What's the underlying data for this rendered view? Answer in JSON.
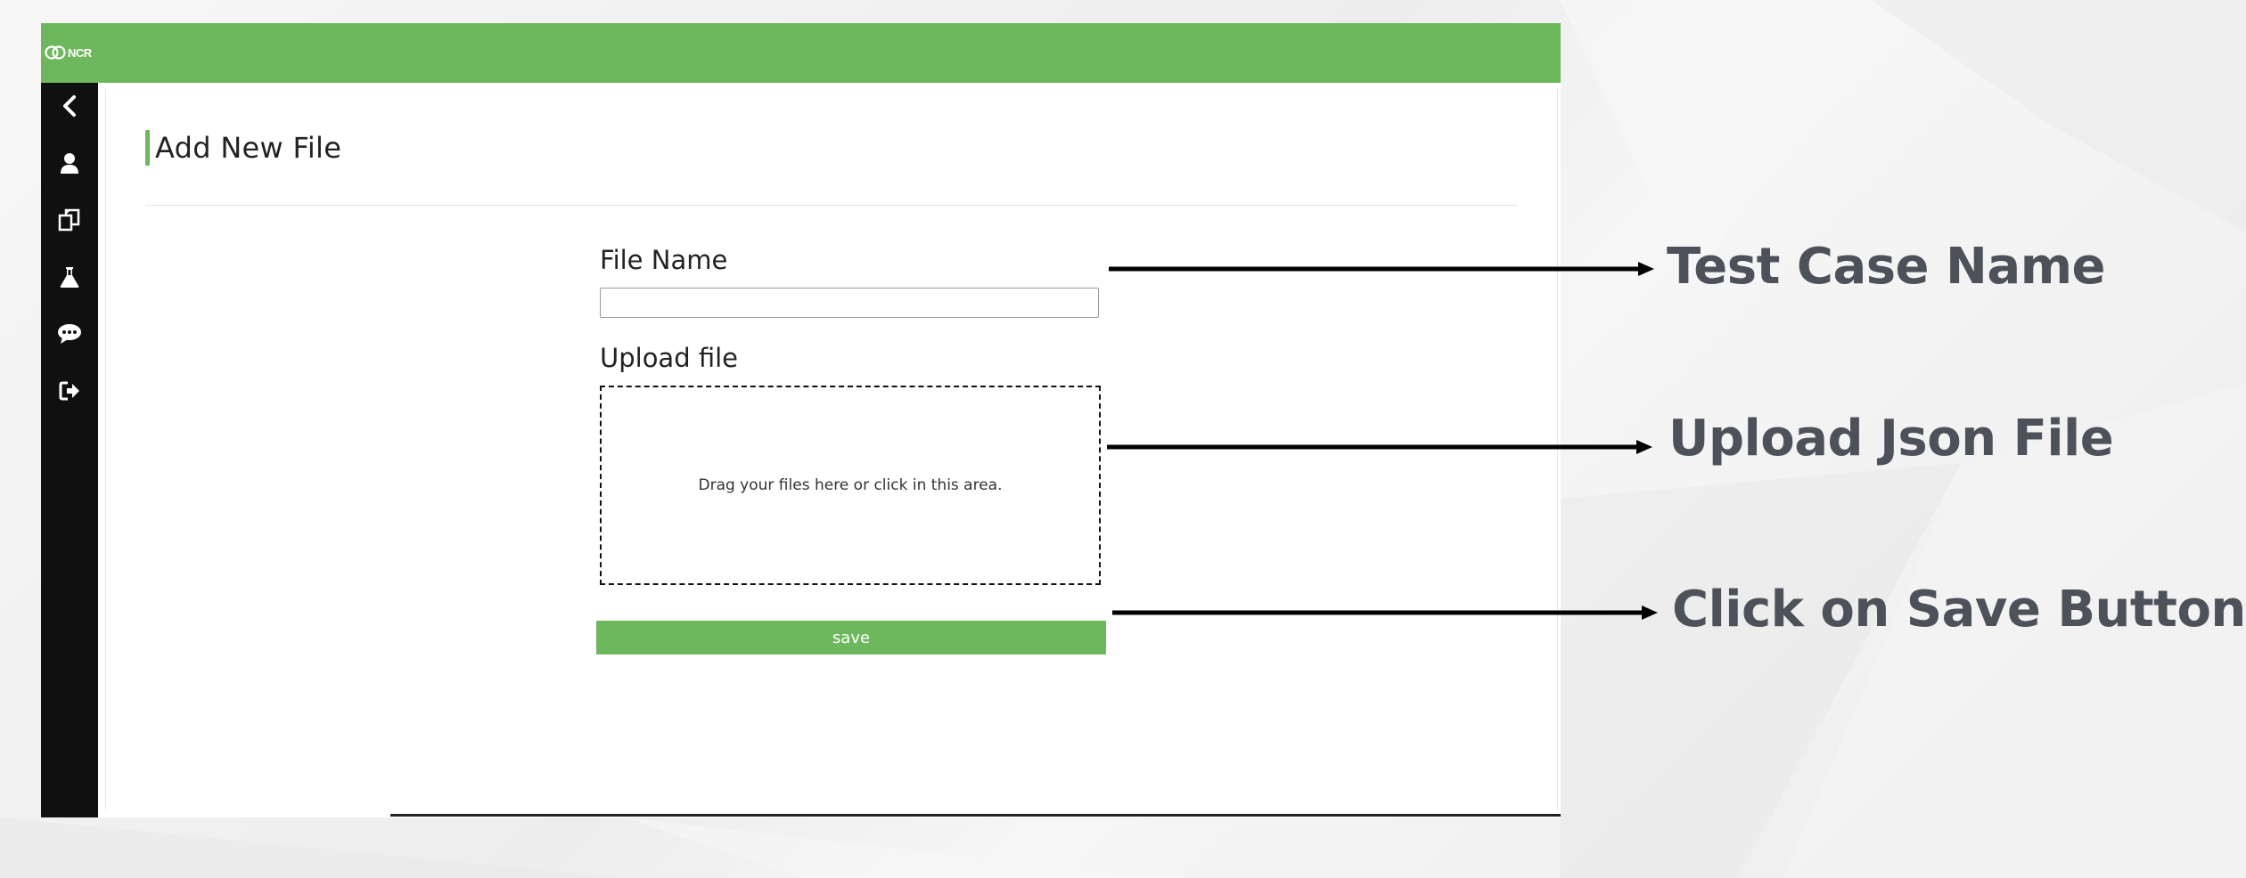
{
  "app": {
    "logo_text": "NCR",
    "page_title": "Add New File"
  },
  "sidebar": {
    "items": [
      {
        "icon": "chevron-left-icon"
      },
      {
        "icon": "user-icon"
      },
      {
        "icon": "files-icon"
      },
      {
        "icon": "flask-icon"
      },
      {
        "icon": "chat-icon"
      },
      {
        "icon": "sign-out-icon"
      }
    ]
  },
  "form": {
    "file_name_label": "File Name",
    "file_name_value": "",
    "upload_label": "Upload file",
    "drop_text": "Drag your files here or click in this area.",
    "save_label": "save"
  },
  "annotations": {
    "test_case_name": "Test Case Name",
    "upload_json": "Upload Json File",
    "click_save": "Click on Save Button"
  },
  "colors": {
    "brand_green": "#6db85c",
    "sidebar": "#101010",
    "annotation_text": "#4d5159"
  }
}
